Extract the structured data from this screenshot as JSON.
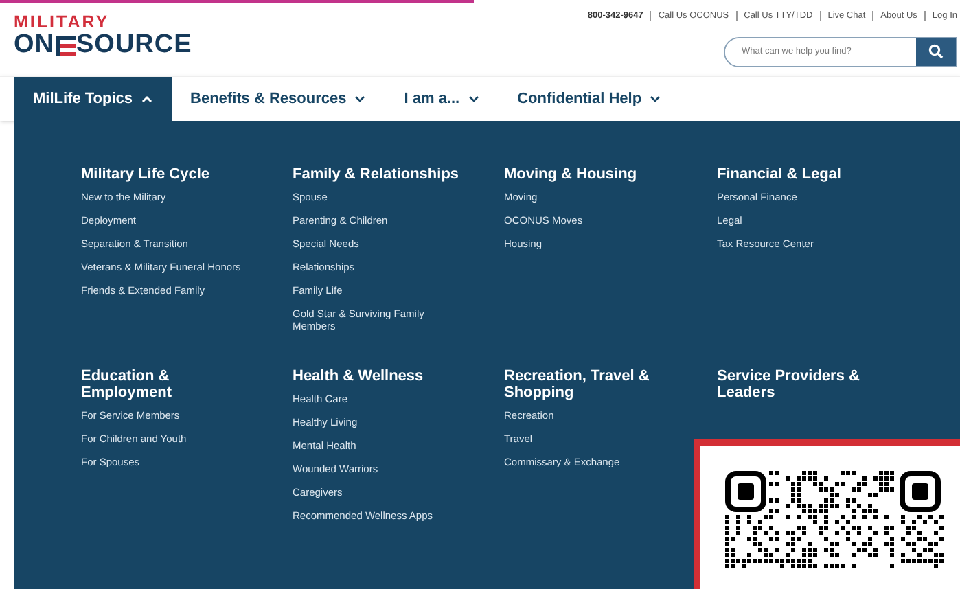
{
  "logo": {
    "top": "MILITARY",
    "bottom_start": "ON",
    "bottom_end": "SOURCE"
  },
  "utility_links": [
    {
      "label": "800-342-9647",
      "kind": "phone"
    },
    {
      "label": "Call Us OCONUS",
      "kind": "link"
    },
    {
      "label": "Call Us TTY/TDD",
      "kind": "link"
    },
    {
      "label": "Live Chat",
      "kind": "link"
    },
    {
      "label": "About Us",
      "kind": "link"
    },
    {
      "label": "Log In",
      "kind": "link"
    }
  ],
  "search": {
    "placeholder": "What can we help you find?"
  },
  "nav": [
    {
      "label": "MilLife Topics",
      "selected": true
    },
    {
      "label": "Benefits & Resources",
      "selected": false
    },
    {
      "label": "I am a...",
      "selected": false
    },
    {
      "label": "Confidential Help",
      "selected": false
    }
  ],
  "menu_sections": [
    {
      "title": "Military Life Cycle",
      "links": [
        "New to the Military",
        "Deployment",
        "Separation & Transition",
        "Veterans & Military Funeral Honors",
        "Friends & Extended Family"
      ]
    },
    {
      "title": "Family & Relationships",
      "links": [
        "Spouse",
        "Parenting & Children",
        "Special Needs",
        "Relationships",
        "Family Life",
        "Gold Star & Surviving Family Members"
      ]
    },
    {
      "title": "Moving & Housing",
      "links": [
        "Moving",
        "OCONUS Moves",
        "Housing"
      ]
    },
    {
      "title": "Financial & Legal",
      "links": [
        "Personal Finance",
        "Legal",
        "Tax Resource Center"
      ]
    },
    {
      "title": "Education & Employment",
      "links": [
        "For Service Members",
        "For Children and Youth",
        "For Spouses"
      ]
    },
    {
      "title": "Health & Wellness",
      "links": [
        "Health Care",
        "Healthy Living",
        "Mental Health",
        "Wounded Warriors",
        "Caregivers",
        "Recommended Wellness Apps"
      ]
    },
    {
      "title": "Recreation, Travel & Shopping",
      "links": [
        "Recreation",
        "Travel",
        "Commissary & Exchange"
      ]
    },
    {
      "title": "Service Providers & Leaders"
    }
  ]
}
